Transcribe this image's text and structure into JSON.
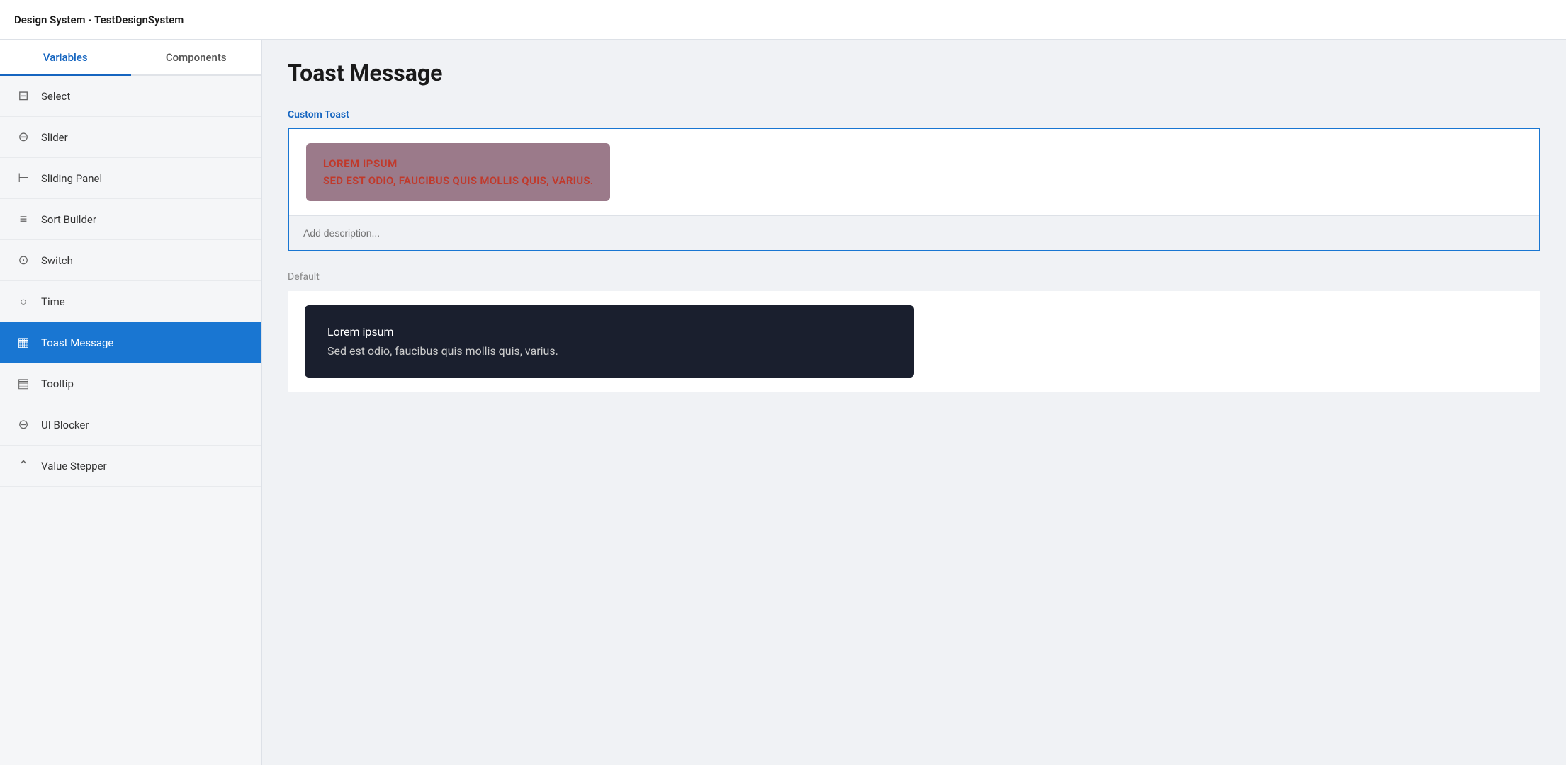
{
  "topbar": {
    "title": "Design System - TestDesignSystem"
  },
  "sidebar": {
    "tabs": [
      {
        "id": "variables",
        "label": "Variables",
        "active": true
      },
      {
        "id": "components",
        "label": "Components",
        "active": false
      }
    ],
    "navItems": [
      {
        "id": "select",
        "label": "Select",
        "icon": "icon-select",
        "active": false
      },
      {
        "id": "slider",
        "label": "Slider",
        "icon": "icon-slider",
        "active": false
      },
      {
        "id": "sliding-panel",
        "label": "Sliding Panel",
        "icon": "icon-sliding-panel",
        "active": false
      },
      {
        "id": "sort-builder",
        "label": "Sort Builder",
        "icon": "icon-sort",
        "active": false
      },
      {
        "id": "switch",
        "label": "Switch",
        "icon": "icon-switch",
        "active": false
      },
      {
        "id": "time",
        "label": "Time",
        "icon": "icon-time",
        "active": false
      },
      {
        "id": "toast-message",
        "label": "Toast Message",
        "icon": "icon-toast",
        "active": true
      },
      {
        "id": "tooltip",
        "label": "Tooltip",
        "icon": "icon-tooltip",
        "active": false
      },
      {
        "id": "ui-blocker",
        "label": "UI Blocker",
        "icon": "icon-ui-blocker",
        "active": false
      },
      {
        "id": "value-stepper",
        "label": "Value Stepper",
        "icon": "icon-value-stepper",
        "active": false
      }
    ]
  },
  "content": {
    "pageTitle": "Toast Message",
    "customToast": {
      "sectionLabel": "Custom Toast",
      "toastTitle": "LOREM IPSUM",
      "toastBody": "SED EST ODIO, FAUCIBUS QUIS MOLLIS QUIS, VARIUS.",
      "descriptionPlaceholder": "Add description..."
    },
    "defaultToast": {
      "sectionLabel": "Default",
      "toastTitle": "Lorem ipsum",
      "toastBody": "Sed est odio, faucibus quis mollis quis, varius."
    }
  }
}
